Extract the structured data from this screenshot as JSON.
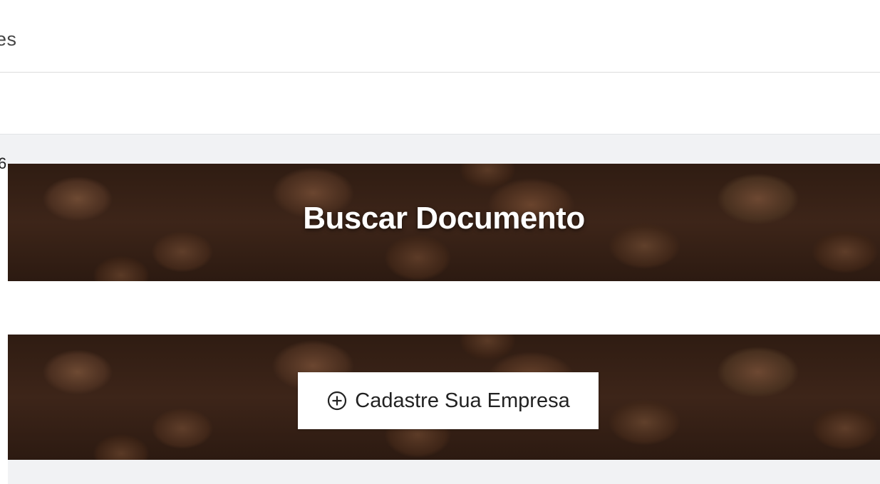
{
  "header": {
    "title_fragment": "es"
  },
  "edge_fragment": "6",
  "search_banner": {
    "title": "Buscar Documento"
  },
  "register_banner": {
    "button_label": "Cadastre Sua Empresa",
    "button_icon": "plus-circle-icon"
  }
}
